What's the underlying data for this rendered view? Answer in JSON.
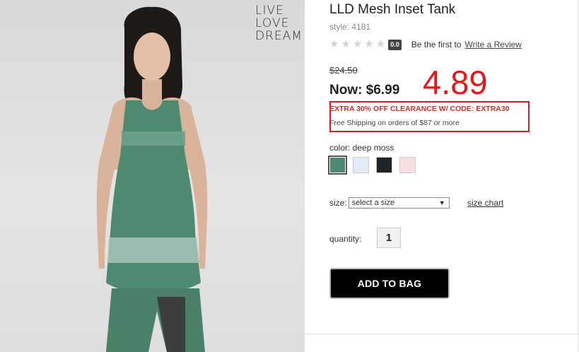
{
  "brand_logo": [
    "LIVE",
    "LOVE",
    "DREAM"
  ],
  "product": {
    "title": "LLD Mesh Inset Tank",
    "style": "style: 4181"
  },
  "rating": {
    "stars": 5,
    "score": "0.0",
    "prompt": "Be the first to",
    "link": "Write a Review"
  },
  "price": {
    "original": "$24.50",
    "now": "Now: $6.99",
    "annotation": "4.89"
  },
  "promo": {
    "code_line": "EXTRA 30% OFF CLEARANCE W/ CODE: EXTRA30",
    "shipping": "Free Shipping on orders of $87 or more"
  },
  "color": {
    "label": "color: deep moss",
    "swatches": [
      {
        "name": "deep moss",
        "hex": "#4e8a72",
        "selected": true
      },
      {
        "name": "light blue",
        "hex": "#e3ebf6",
        "selected": false
      },
      {
        "name": "black",
        "hex": "#1d2326",
        "selected": false
      },
      {
        "name": "pink",
        "hex": "#f6e0e2",
        "selected": false
      }
    ]
  },
  "size": {
    "label": "size:",
    "selected": "select a size",
    "chart_link": "size chart"
  },
  "quantity": {
    "label": "quantity:",
    "value": "1"
  },
  "actions": {
    "add_to_bag": "ADD TO BAG"
  },
  "colors": {
    "promo_red": "#e01a1a",
    "tank_green": "#4e8a72"
  }
}
